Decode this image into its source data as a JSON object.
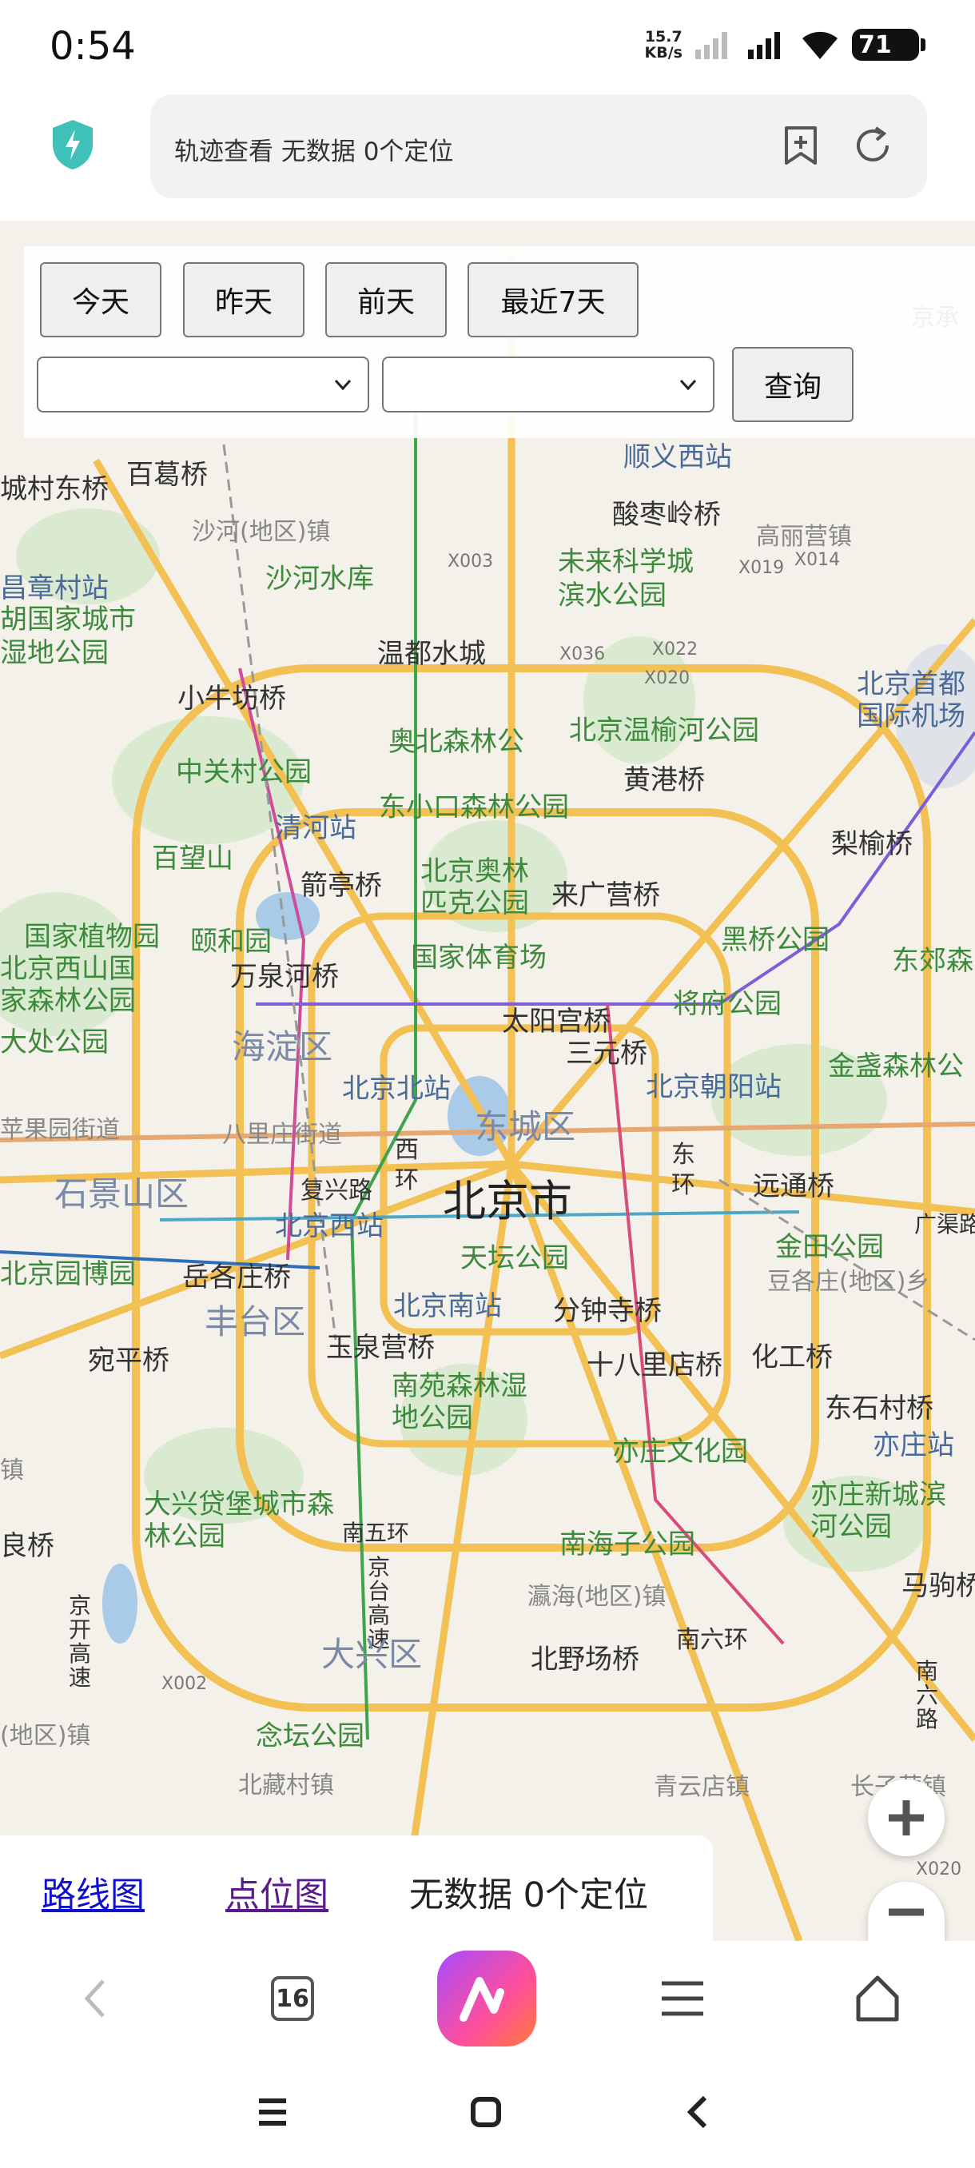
{
  "status": {
    "time": "0:54",
    "net_speed_value": "15.7",
    "net_speed_unit": "KB/s",
    "battery": "71"
  },
  "browser": {
    "url_text": "轨迹查看 无数据 0个定位",
    "tab_count": "16"
  },
  "controls": {
    "today": "今天",
    "yesterday": "昨天",
    "day_before": "前天",
    "last7": "最近7天",
    "query": "查询",
    "select_start_value": "",
    "select_end_value": ""
  },
  "info_bar": {
    "route_link": "路线图",
    "points_link": "点位图",
    "summary": "无数据 0个定位"
  },
  "map": {
    "labels": {
      "shunyi_west": "顺义西站",
      "suanzaoling": "酸枣岭桥",
      "gaoliying": "高丽营镇",
      "jinglu": "京承",
      "chengcun": "城村东桥",
      "ligeqiao": "百葛桥",
      "shahe_town": "沙河(地区)镇",
      "shahe_res": "沙河水库",
      "weilai": "未来科学城滨水公园",
      "x003": "X003",
      "x019": "X019",
      "x014": "X014",
      "changzhang": "昌章村站",
      "huguo": "胡国家城市湿地公园",
      "wendu": "温都水城",
      "x036": "X036",
      "x022": "X022",
      "x020": "X020",
      "capital_airport": "北京首都国际机场",
      "xiaoniufang": "小牛坊桥",
      "aobei_forest": "奥北森林公",
      "wenyu": "北京温榆河公园",
      "huanggang": "黄港桥",
      "zhongguancun": "中关村公园",
      "qinghe": "清河站",
      "dongxiaokou": "东小口森林公园",
      "lishu": "梨榆桥",
      "baiwangshan": "百望山",
      "jianting": "箭亭桥",
      "olympic": "北京奥林匹克公园",
      "laiguangying": "来广营桥",
      "botanic": "国家植物园",
      "yihe": "颐和园",
      "national_stadium": "国家体育场",
      "heiqiao": "黑桥公园",
      "dongjiao": "东郊森",
      "xishan": "北京西山国家森林公园",
      "dajue": "大处公园",
      "wanquanhe": "万泉河桥",
      "taiyanggong": "太阳宫桥",
      "jiangfu": "将府公园",
      "haidian": "海淀区",
      "sanyuan": "三元桥",
      "beijing_north": "北京北站",
      "chaoyang_st": "北京朝阳站",
      "jinzhan": "金盏森林公",
      "pingguoyuan": "苹果园街道",
      "babaozhuang": "八里庄街道",
      "dongcheng": "东城区",
      "shijingshan": "石景山区",
      "xihuan": "西环",
      "fuxinglu": "复兴路",
      "beijing_city": "北京市",
      "donghuan": "东环",
      "yuantong": "远通桥",
      "guangqu": "广渠路",
      "beijing_west": "北京西站",
      "tiantan": "天坛公园",
      "jintian": "金田公园",
      "douge": "豆各庄(地区)乡",
      "garden_expo": "北京园博园",
      "yuegezhuang": "岳各庄桥",
      "fengtai": "丰台区",
      "beijing_south": "北京南站",
      "fenzhong": "分钟寺桥",
      "wanping": "宛平桥",
      "yuquanying": "玉泉营桥",
      "shibali": "十八里店桥",
      "huagong": "化工桥",
      "nanyuan": "南苑森林湿地公园",
      "dongshicun": "东石村桥",
      "yizhuang_st": "亦庄站",
      "yizhuang_culture": "亦庄文化园",
      "daxing_fort": "大兴贷堡城市森林公园",
      "yizhuang_newtown": "亦庄新城滨河公园",
      "nanwuhuan": "南五环",
      "nanhaizi": "南海子公园",
      "majuqiao": "马驹桥",
      "liangshi": "良桥",
      "yinghai": "瀛海(地区)镇",
      "jinghu": "京台高速",
      "daxing": "大兴区",
      "beiyechang": "北野场桥",
      "nanliu": "南六环",
      "x002": "X002",
      "nianfan": "念坛公园",
      "beizang": "北藏村镇",
      "qingyundian": "青云店镇",
      "changziying": "长子营镇",
      "x020b": "X020",
      "zhen_left": "镇",
      "huangcun_left": "(地区)镇",
      "jingkai": "京开高速",
      "zhinanlu": "南六路"
    }
  },
  "nav": {}
}
